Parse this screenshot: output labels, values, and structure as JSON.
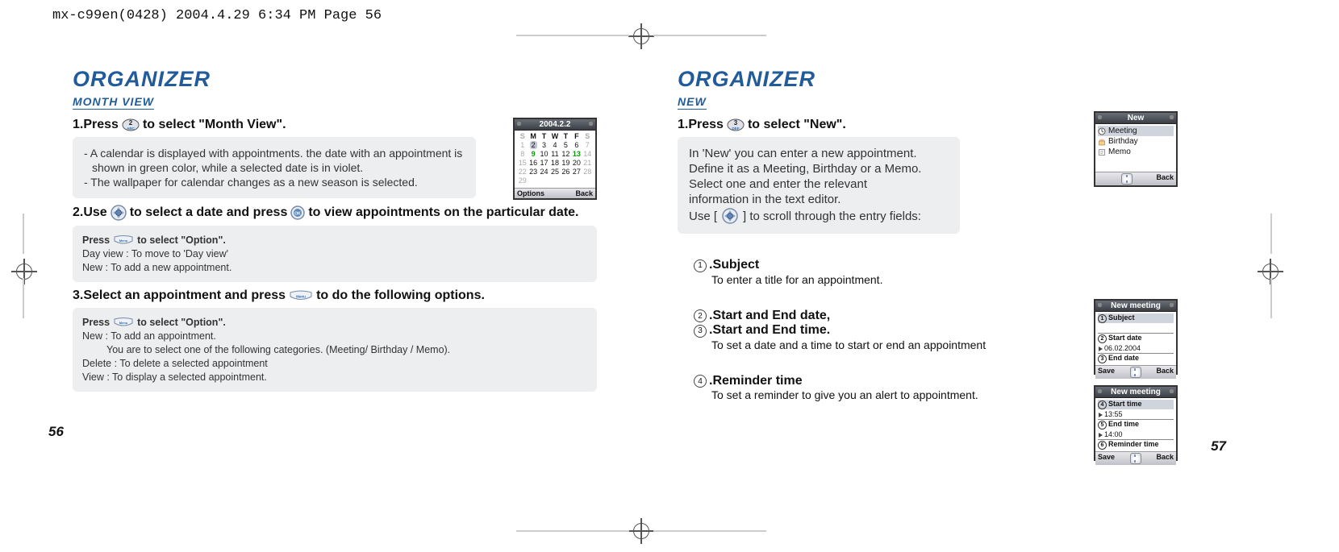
{
  "header_info": "mx-c99en(0428)  2004.4.29  6:34 PM  Page 56",
  "left": {
    "title": "ORGANIZER",
    "section": "MONTH VIEW",
    "step1_a": "1.Press",
    "step1_b": "to select \"Month View\".",
    "note1_l1": "- A calendar is displayed with appointments. the date with an appointment is",
    "note1_l2": "  shown in green color, while a selected date is in violet.",
    "note1_l3": "- The wallpaper for calendar changes as a new season is selected.",
    "step2_a": "2.Use",
    "step2_b": "to select a date and press",
    "step2_c": "to view appointments on the particular date.",
    "opt1_h": "Press",
    "opt1_h2": "to select \"Option\".",
    "opt1_l1": "Day view : To move to 'Day view'",
    "opt1_l2": "New : To add a new appointment.",
    "step3_a": "3.Select an appointment and press",
    "step3_b": "to do the following options.",
    "opt2_h": "Press",
    "opt2_h2": "to select \"Option\".",
    "opt2_l1": "New : To add an appointment.",
    "opt2_l2": "You are to select one of the following categories. (Meeting/ Birthday / Memo).",
    "opt2_l3": "Delete : To delete a selected appointment",
    "opt2_l4": "View : To display a selected appointment.",
    "page_num": "56"
  },
  "right": {
    "title": "ORGANIZER",
    "section": "NEW",
    "step1_a": "1.Press",
    "step1_b": "to select \"New\".",
    "intro_l1": "In 'New' you can enter a new appointment.",
    "intro_l2": "Define it as a Meeting, Birthday or a Memo.",
    "intro_l3": "Select one and enter the relevant",
    "intro_l4": "information in the text editor.",
    "intro_l5a": "Use [",
    "intro_l5b": "] to scroll through the entry fields:",
    "f1_label": ".Subject",
    "f1_desc": "To enter a title for an appointment.",
    "f2_label": ".Start and End date,",
    "f3_label": ".Start and End time.",
    "f23_desc": "To set a date and a time to start or end an appointment",
    "f4_label": ".Reminder time",
    "f4_desc": "To set a reminder to give you an alert to appointment.",
    "page_num": "57"
  },
  "cal": {
    "title": "2004.2.2",
    "dh": [
      "S",
      "M",
      "T",
      "W",
      "T",
      "F",
      "S"
    ],
    "w1": [
      "1",
      "2",
      "3",
      "4",
      "5",
      "6",
      "7"
    ],
    "w2": [
      "8",
      "9",
      "10",
      "11",
      "12",
      "13",
      "14"
    ],
    "w3": [
      "15",
      "16",
      "17",
      "18",
      "19",
      "20",
      "21"
    ],
    "w4": [
      "22",
      "23",
      "24",
      "25",
      "26",
      "27",
      "28"
    ],
    "w5_0": "29",
    "sk_left": "Options",
    "sk_right": "Back"
  },
  "new_screen": {
    "title": "New",
    "item1": "Meeting",
    "item2": "Birthday",
    "item3": "Memo",
    "sk_right": "Back"
  },
  "nm1": {
    "title": "New meeting",
    "f1": "Subject",
    "f2": "Start date",
    "f2v": "06.02.2004",
    "f3": "End date",
    "sk_left": "Save",
    "sk_right": "Back"
  },
  "nm2": {
    "title": "New meeting",
    "f4": "Start time",
    "f4v": "13:55",
    "f5": "End time",
    "f5v": "14:00",
    "f6": "Reminder time",
    "sk_left": "Save",
    "sk_right": "Back"
  }
}
